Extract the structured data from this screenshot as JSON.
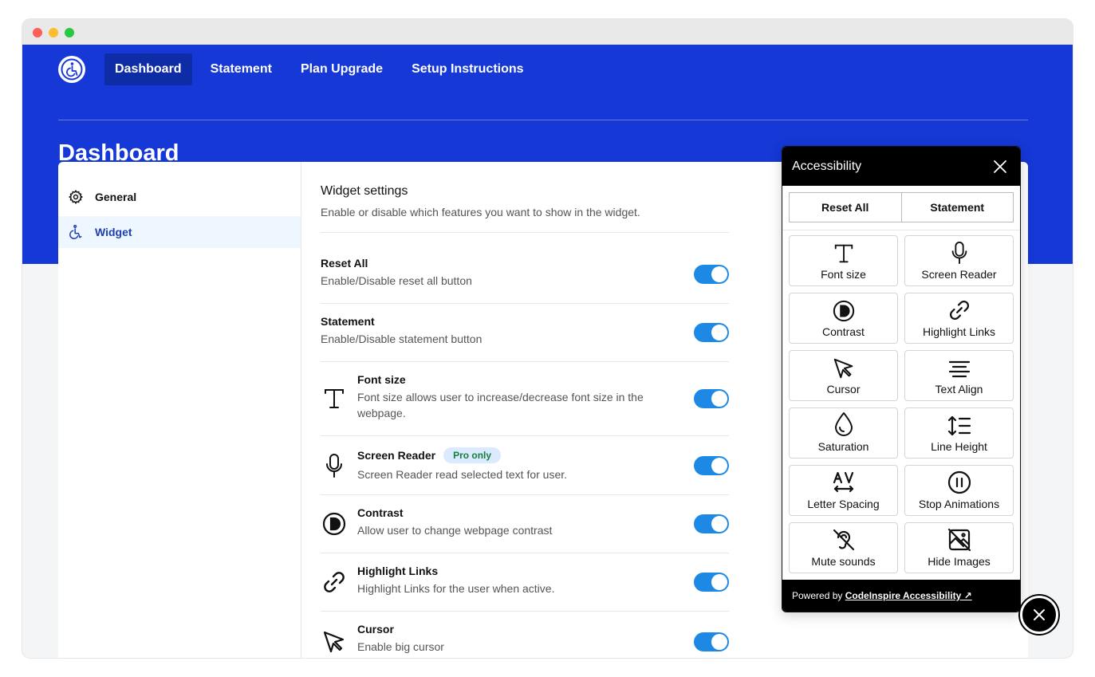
{
  "nav": {
    "items": [
      {
        "label": "Dashboard",
        "active": true
      },
      {
        "label": "Statement"
      },
      {
        "label": "Plan Upgrade"
      },
      {
        "label": "Setup Instructions"
      }
    ]
  },
  "page": {
    "title": "Dashboard"
  },
  "sidebar": {
    "items": [
      {
        "label": "General",
        "icon": "gear-icon"
      },
      {
        "label": "Widget",
        "icon": "wheelchair-icon",
        "active": true
      }
    ]
  },
  "widget_settings": {
    "title": "Widget settings",
    "subtitle": "Enable or disable which features you want to show in the widget.",
    "rows": [
      {
        "title": "Reset All",
        "desc": "Enable/Disable reset all button",
        "enabled": true
      },
      {
        "title": "Statement",
        "desc": "Enable/Disable statement button",
        "enabled": true
      },
      {
        "title": "Font size",
        "desc": "Font size allows user to increase/decrease font size in the webpage.",
        "icon": "font-size-icon",
        "enabled": true
      },
      {
        "title": "Screen Reader",
        "badge": "Pro only",
        "desc": "Screen Reader read selected text for user.",
        "icon": "microphone-icon",
        "enabled": true
      },
      {
        "title": "Contrast",
        "desc": "Allow user to change webpage contrast",
        "icon": "contrast-icon",
        "enabled": true
      },
      {
        "title": "Highlight Links",
        "desc": "Highlight Links for the user when active.",
        "icon": "link-icon",
        "enabled": true
      },
      {
        "title": "Cursor",
        "desc": "Enable big cursor",
        "icon": "cursor-icon",
        "enabled": true
      }
    ]
  },
  "panel": {
    "title": "Accessibility",
    "reset_label": "Reset All",
    "statement_label": "Statement",
    "tiles": [
      {
        "label": "Font size",
        "icon": "font-size-icon"
      },
      {
        "label": "Screen Reader",
        "icon": "microphone-icon"
      },
      {
        "label": "Contrast",
        "icon": "contrast-icon"
      },
      {
        "label": "Highlight Links",
        "icon": "link-icon"
      },
      {
        "label": "Cursor",
        "icon": "cursor-icon"
      },
      {
        "label": "Text Align",
        "icon": "text-align-icon"
      },
      {
        "label": "Saturation",
        "icon": "droplet-icon"
      },
      {
        "label": "Line Height",
        "icon": "line-height-icon"
      },
      {
        "label": "Letter Spacing",
        "icon": "letter-spacing-icon"
      },
      {
        "label": "Stop Animations",
        "icon": "pause-icon"
      },
      {
        "label": "Mute sounds",
        "icon": "mute-icon"
      },
      {
        "label": "Hide Images",
        "icon": "hide-image-icon"
      }
    ],
    "footer_prefix": "Powered by ",
    "footer_link": "CodeInspire Accessibility ↗"
  },
  "colors": {
    "brand": "#1538d6",
    "toggle_on": "#1e88e5"
  }
}
